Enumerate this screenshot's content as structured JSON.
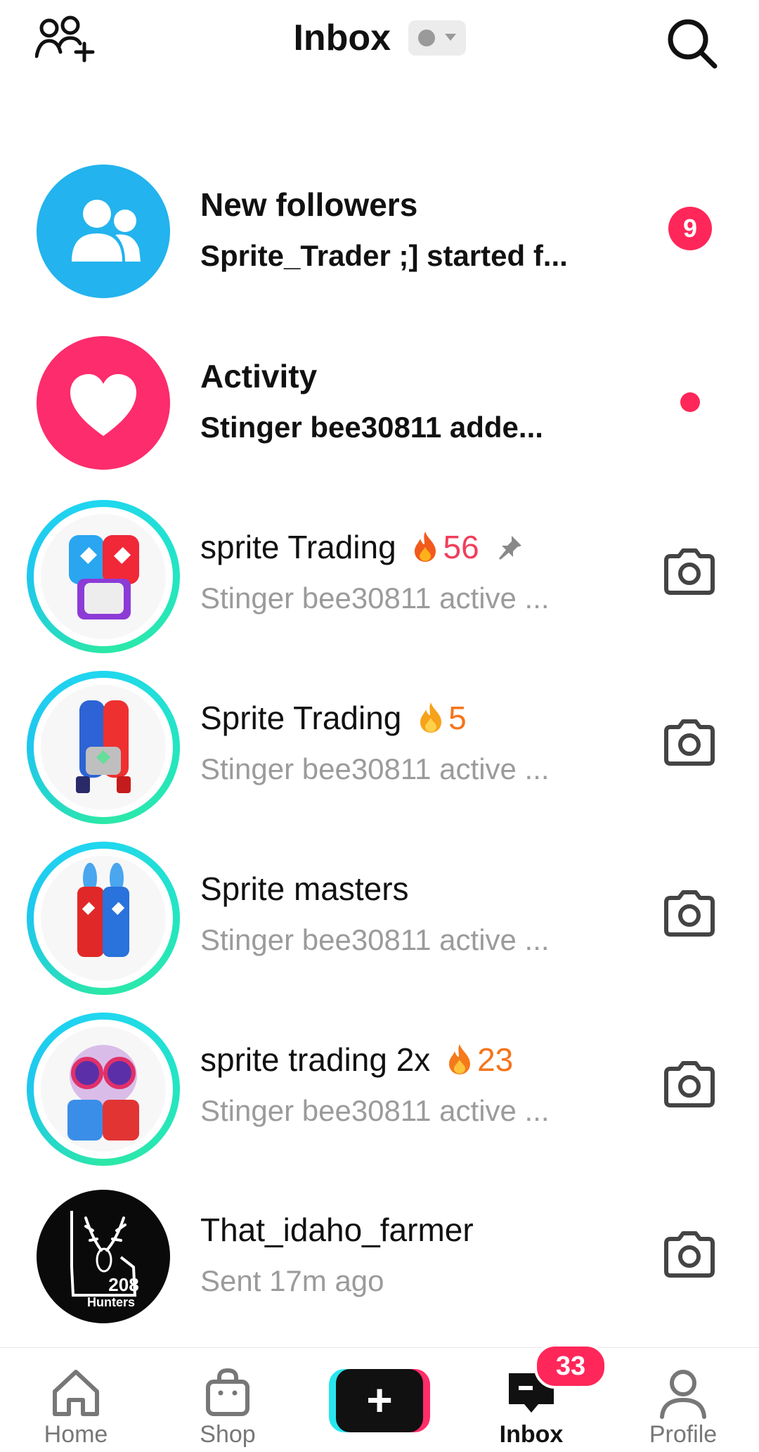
{
  "header": {
    "title": "Inbox",
    "add_friends_icon": "add-friends-icon",
    "status_icon": "status-dot-icon",
    "search_icon": "search-icon"
  },
  "system_rows": [
    {
      "title": "New followers",
      "subtitle": "Sprite_Trader ;] started f...",
      "icon": "people-icon",
      "icon_bg": "#23B3EE",
      "badge": "9"
    },
    {
      "title": "Activity",
      "subtitle": "Stinger bee30811 adde...",
      "icon": "heart-icon",
      "icon_bg": "#FD2C6C",
      "unread_dot": true
    }
  ],
  "conversations": [
    {
      "name": "sprite Trading",
      "streak": "56",
      "streak_color": "#F13E5C",
      "pinned": true,
      "subtitle": "Stinger bee30811 active ...",
      "action_icon": "camera-icon"
    },
    {
      "name": "Sprite Trading",
      "streak": "5",
      "streak_color": "#F4751C",
      "subtitle": "Stinger bee30811 active ...",
      "action_icon": "camera-icon"
    },
    {
      "name": "Sprite masters",
      "subtitle": "Stinger bee30811 active ...",
      "action_icon": "camera-icon"
    },
    {
      "name": "sprite trading 2x",
      "streak": "23",
      "streak_color": "#F4751C",
      "subtitle": "Stinger bee30811 active ...",
      "action_icon": "camera-icon"
    },
    {
      "name": "That_idaho_farmer",
      "subtitle": "Sent 17m ago",
      "action_icon": "camera-icon",
      "avatar_text_1": "208",
      "avatar_text_2": "Hunters"
    }
  ],
  "bottom_nav": {
    "items": [
      {
        "label": "Home",
        "icon": "home-icon"
      },
      {
        "label": "Shop",
        "icon": "shop-bag-icon"
      },
      {
        "label": "",
        "icon": "create-plus-icon"
      },
      {
        "label": "Inbox",
        "icon": "inbox-message-icon",
        "badge": "33",
        "active": true
      },
      {
        "label": "Profile",
        "icon": "profile-icon"
      }
    ]
  },
  "colors": {
    "accent_red": "#FF2759",
    "muted_text": "#9B9B9B",
    "ring_cyan": "#20D7F0",
    "ring_green": "#2CE8A6"
  }
}
